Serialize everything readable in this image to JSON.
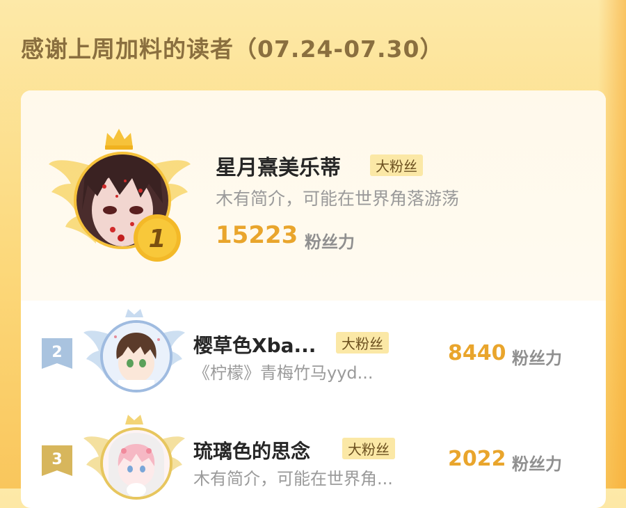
{
  "title": "感谢上周加料的读者（07.24-07.30）",
  "fan_badge": "大粉丝",
  "power_unit": "粉丝力",
  "readers": [
    {
      "rank": "1",
      "name": "星月熹美乐蒂",
      "desc": "木有简介，可能在世界角落游荡",
      "power": "15223"
    },
    {
      "rank": "2",
      "name": "樱草色Xba...",
      "desc": "《柠檬》青梅竹马yyd...",
      "power": "8440"
    },
    {
      "rank": "3",
      "name": "琉璃色的思念",
      "desc": "木有简介，可能在世界角...",
      "power": "2022"
    }
  ],
  "colors": {
    "background": "#fcd87a",
    "accent_gold": "#e9a52c",
    "badge_bg": "#fbe8a6",
    "rank2": "#a9c3df",
    "rank3": "#d7b65c"
  },
  "icons": [
    "crown-icon",
    "wings-icon",
    "rank-medal-icon"
  ]
}
